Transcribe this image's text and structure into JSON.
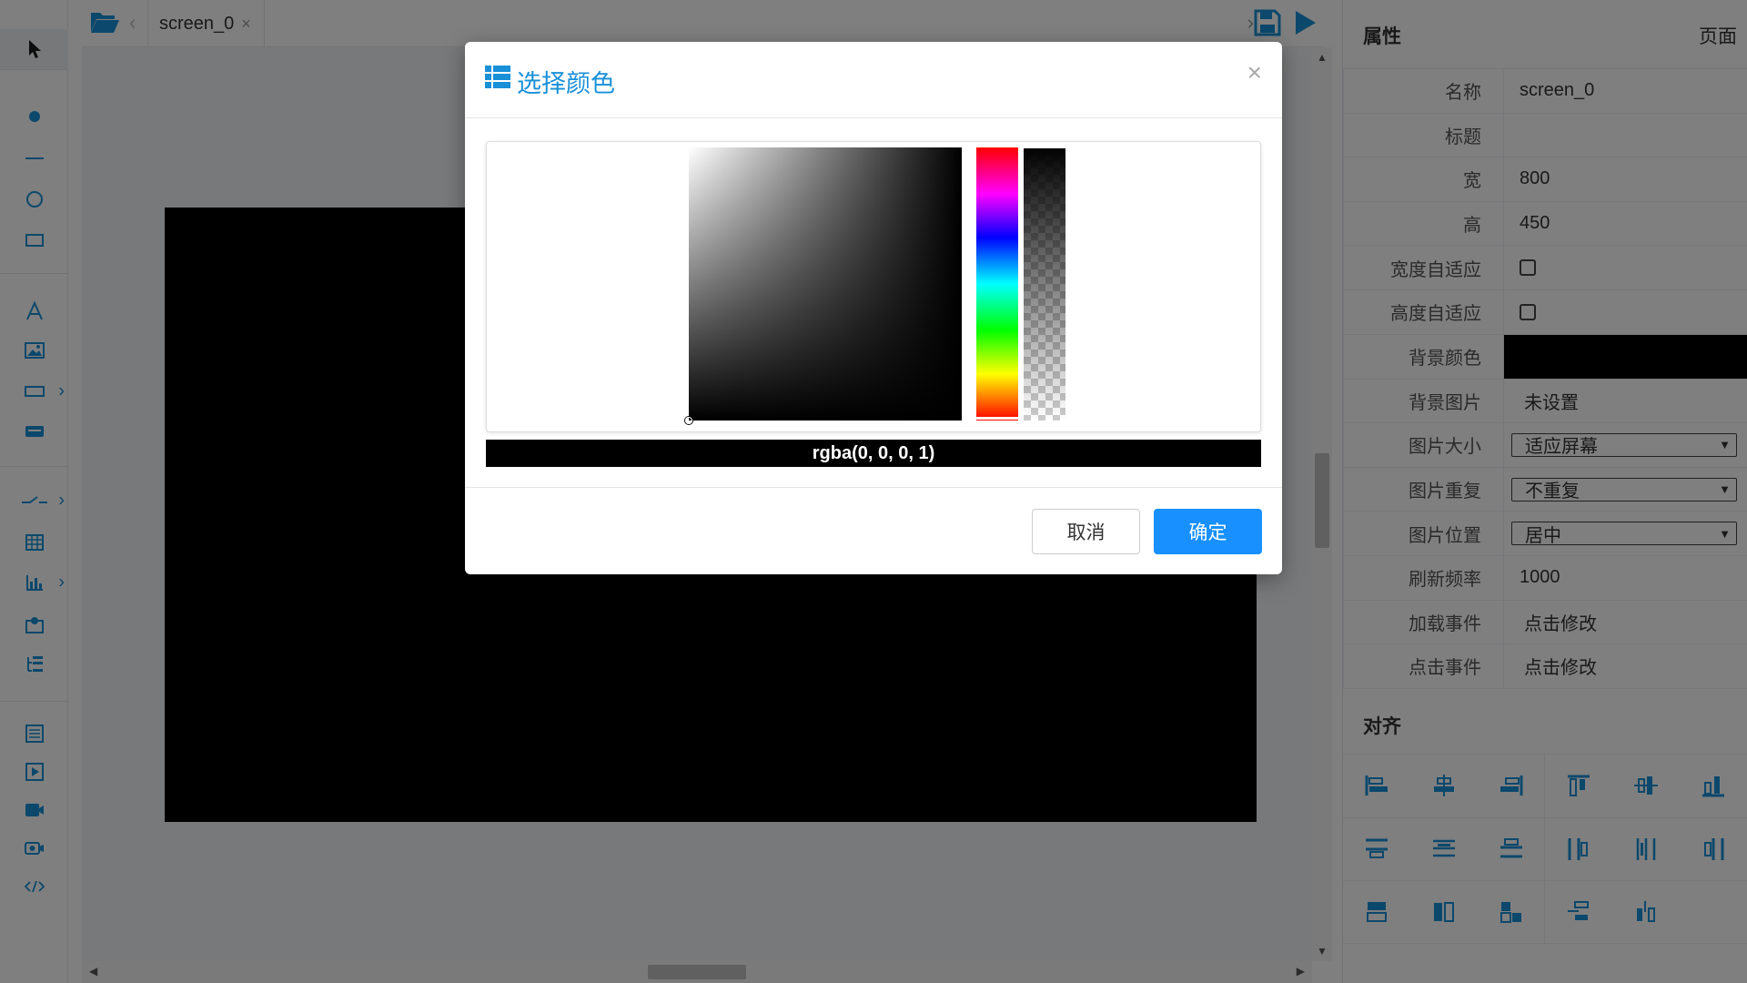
{
  "colors": {
    "accent": "#1890d8",
    "primary_button": "#1890ff",
    "canvas_background": "#000000"
  },
  "toolbar": {
    "tools": [
      {
        "name": "pointer-tool",
        "icon": "cursor-arrow-icon"
      },
      {
        "name": "point-tool",
        "icon": "dot-icon"
      },
      {
        "name": "line-tool",
        "icon": "line-icon"
      },
      {
        "name": "circle-tool",
        "icon": "circle-icon"
      },
      {
        "name": "rectangle-tool",
        "icon": "rectangle-icon"
      },
      {
        "name": "text-tool",
        "icon": "text-a-icon"
      },
      {
        "name": "image-tool",
        "icon": "image-icon"
      },
      {
        "name": "input-tool",
        "icon": "input-box-icon",
        "has_submenu": true
      },
      {
        "name": "button-tool",
        "icon": "button-icon"
      },
      {
        "name": "switch-tool",
        "icon": "switch-icon",
        "has_submenu": true
      },
      {
        "name": "table-tool",
        "icon": "table-icon"
      },
      {
        "name": "chart-tool",
        "icon": "bar-chart-icon",
        "has_submenu": true
      },
      {
        "name": "map-tool",
        "icon": "map-icon"
      },
      {
        "name": "tree-tool",
        "icon": "tree-list-icon"
      },
      {
        "name": "list-tool",
        "icon": "list-icon"
      },
      {
        "name": "media-tool",
        "icon": "play-icon"
      },
      {
        "name": "video-tool",
        "icon": "video-camera-icon"
      },
      {
        "name": "camera-tool",
        "icon": "camera-icon"
      },
      {
        "name": "code-tool",
        "icon": "code-icon"
      }
    ]
  },
  "tabbar": {
    "tab_label": "screen_0",
    "close_glyph": "×",
    "prev_glyph": "‹",
    "next_glyph": "›"
  },
  "properties": {
    "title": "属性",
    "page_tab": "页面",
    "rows": [
      {
        "label": "名称",
        "value": "screen_0"
      },
      {
        "label": "标题",
        "value": ""
      },
      {
        "label": "宽",
        "value": "800"
      },
      {
        "label": "高",
        "value": "450"
      },
      {
        "label": "宽度自适应",
        "checked": false
      },
      {
        "label": "高度自适应",
        "checked": false
      },
      {
        "label": "背景颜色",
        "color": "#000000"
      },
      {
        "label": "背景图片",
        "value": "未设置"
      },
      {
        "label": "图片大小",
        "selected": "适应屏幕"
      },
      {
        "label": "图片重复",
        "selected": "不重复"
      },
      {
        "label": "图片位置",
        "selected": "居中"
      },
      {
        "label": "刷新频率",
        "value": "1000"
      },
      {
        "label": "加载事件",
        "value": "点击修改"
      },
      {
        "label": "点击事件",
        "value": "点击修改"
      }
    ]
  },
  "align": {
    "title": "对齐",
    "buttons": [
      "align-left-icon",
      "align-center-h-icon",
      "align-right-icon",
      "align-top-icon",
      "align-middle-v-icon",
      "align-bottom-icon",
      "distribute-top-icon",
      "distribute-middle-icon",
      "distribute-bottom-icon",
      "distribute-left-icon",
      "distribute-center-icon",
      "distribute-right-icon",
      "same-width-icon",
      "same-height-icon",
      "same-size-icon",
      "space-horizontal-icon",
      "space-vertical-icon"
    ]
  },
  "dialog": {
    "title": "选择颜色",
    "close_glyph": "×",
    "color_value": "rgba(0, 0, 0, 1)",
    "cancel_label": "取消",
    "ok_label": "确定"
  }
}
